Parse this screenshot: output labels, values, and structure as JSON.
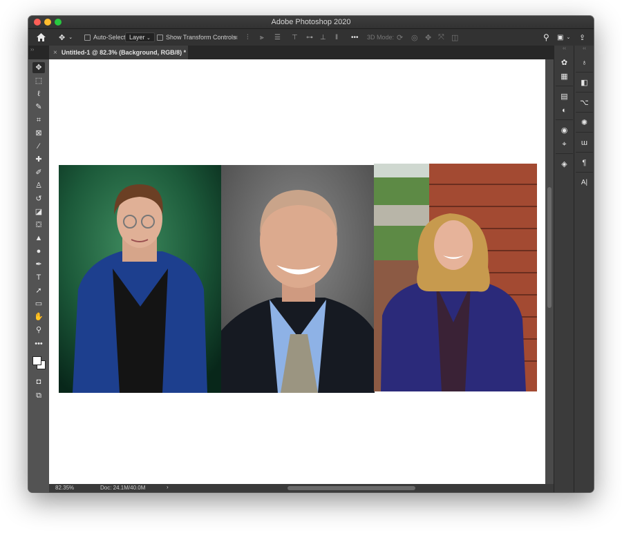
{
  "window": {
    "title": "Adobe Photoshop 2020"
  },
  "options_bar": {
    "auto_select_label": "Auto-Select:",
    "auto_select_value": "Layer",
    "transform_label": "Show Transform Controls",
    "more": "•••",
    "mode_label": "3D Mode:"
  },
  "document_tab": {
    "close": "×",
    "title": "Untitled-1 @ 82.3% (Background, RGB/8) *"
  },
  "toolbar": {
    "tools": [
      {
        "name": "move-tool",
        "glyph": "✥"
      },
      {
        "name": "marquee-tool",
        "glyph": "⬚"
      },
      {
        "name": "lasso-tool",
        "glyph": "ℓ"
      },
      {
        "name": "quick-selection-tool",
        "glyph": "✎"
      },
      {
        "name": "crop-tool",
        "glyph": "⌗"
      },
      {
        "name": "frame-tool",
        "glyph": "⊠"
      },
      {
        "name": "eyedropper-tool",
        "glyph": "⁄"
      },
      {
        "name": "healing-brush-tool",
        "glyph": "✚"
      },
      {
        "name": "brush-tool",
        "glyph": "✐"
      },
      {
        "name": "clone-stamp-tool",
        "glyph": "♙"
      },
      {
        "name": "history-brush-tool",
        "glyph": "↺"
      },
      {
        "name": "eraser-tool",
        "glyph": "◪"
      },
      {
        "name": "paint-bucket-tool",
        "glyph": "⛋"
      },
      {
        "name": "blur-tool",
        "glyph": "▲"
      },
      {
        "name": "dodge-tool",
        "glyph": "●"
      },
      {
        "name": "pen-tool",
        "glyph": "✒"
      },
      {
        "name": "type-tool",
        "glyph": "T"
      },
      {
        "name": "path-selection-tool",
        "glyph": "➚"
      },
      {
        "name": "rectangle-tool",
        "glyph": "▭"
      },
      {
        "name": "hand-tool",
        "glyph": "✋"
      },
      {
        "name": "zoom-tool",
        "glyph": "⚲"
      },
      {
        "name": "edit-toolbar",
        "glyph": "•••"
      }
    ]
  },
  "status_bar": {
    "zoom": "82.35%",
    "doc": "Doc: 24.1M/40.0M",
    "arrow": "›"
  },
  "dock": {
    "left_icons": [
      "color-icon",
      "swatches-icon",
      "libraries-icon",
      "adjustments-icon",
      "channels-icon",
      "paths-icon",
      "layers-icon"
    ],
    "right_icons": [
      "learn-icon",
      "properties-icon",
      "history-icon",
      "brushes-icon",
      "character-icon",
      "paragraph-icon",
      "glyphs-icon"
    ],
    "paragraph_glyph": "¶",
    "glyphs_glyph": "A|"
  },
  "colors": {
    "accent_close": "#ff5f57",
    "accent_min": "#febc2e",
    "accent_max": "#28c840",
    "panel": "#535353",
    "dark": "#323232"
  }
}
